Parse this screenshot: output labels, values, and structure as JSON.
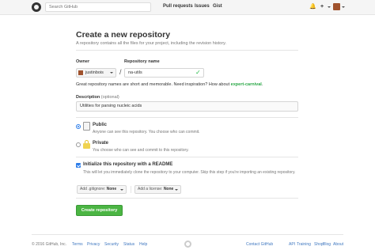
{
  "header": {
    "search_placeholder": "Search GitHub",
    "nav": {
      "pulls": "Pull requests",
      "issues": "Issues",
      "gist": "Gist"
    },
    "icons": {
      "bell": "🔔",
      "plus": "+"
    }
  },
  "page": {
    "title": "Create a new repository",
    "subtitle": "A repository contains all the files for your project, including the revision history."
  },
  "form": {
    "owner_label": "Owner",
    "owner_value": "justinbois",
    "repo_label": "Repository name",
    "slash": "/",
    "repo_value": "na-utils",
    "hint_text": "Great repository names are short and memorable. Need inspiration? How about ",
    "hint_suggestion": "expert-carnival",
    "hint_end": ".",
    "desc_label": "Description",
    "desc_optional": "(optional)",
    "desc_value": "Utilities for parsing nucleic acids",
    "public_title": "Public",
    "public_desc": "Anyone can see this repository. You choose who can commit.",
    "private_title": "Private",
    "private_desc": "You choose who can see and commit to this repository.",
    "init_title": "Initialize this repository with a README",
    "init_desc": "This will let you immediately clone the repository to your computer. Skip this step if you're importing an existing repository.",
    "gitignore_label": "Add .gitignore:",
    "gitignore_value": "None",
    "license_label": "Add a license:",
    "license_value": "None",
    "create_label": "Create repository",
    "selected_visibility": "public",
    "readme_checked": true,
    "check_icon": "✓"
  },
  "footer": {
    "copyright": "© 2016 GitHub, Inc.",
    "left_links": [
      "Terms",
      "Privacy",
      "Security",
      "Status",
      "Help"
    ],
    "right_links": [
      "Contact GitHub",
      "API",
      "Training",
      "Shop",
      "Blog",
      "About"
    ]
  },
  "colors": {
    "accent_blue": "#4078c0",
    "create_green": "#4bb543",
    "suggestion_green": "#28a745",
    "lock_yellow": "#f0d34f"
  }
}
